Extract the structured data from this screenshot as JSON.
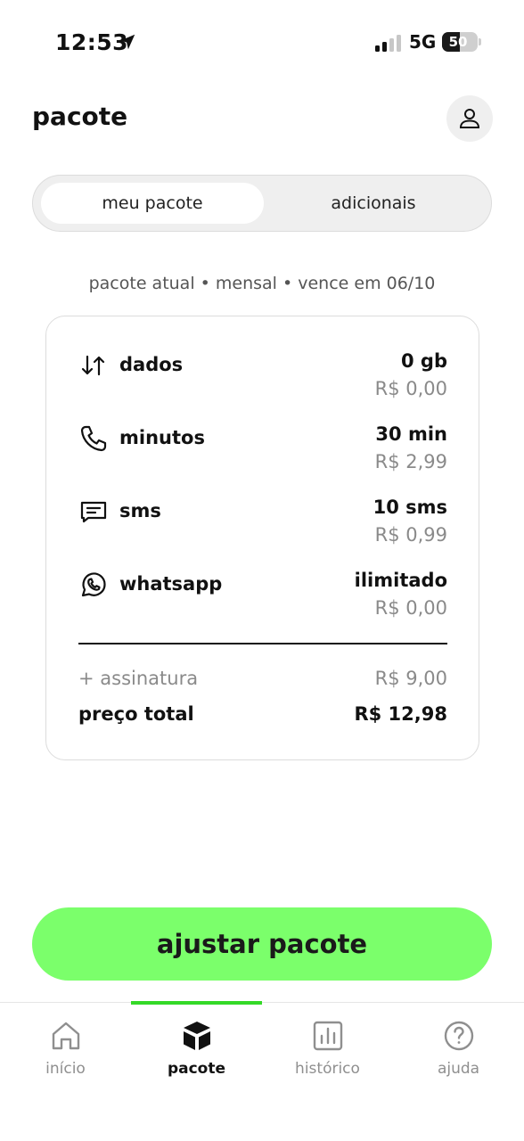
{
  "status_bar": {
    "time": "12:53",
    "network": "5G",
    "battery": "50",
    "battery_level": 0.5,
    "icons": [
      "location-arrow-icon",
      "signal-icon",
      "battery-icon"
    ]
  },
  "header": {
    "title": "pacote",
    "profile_icon": "user-icon"
  },
  "tabs": [
    {
      "label": "meu pacote",
      "active": true
    },
    {
      "label": "adicionais",
      "active": false
    }
  ],
  "plan": {
    "subtitle": "pacote atual • mensal • vence em 06/10",
    "items": [
      {
        "icon": "data-transfer-icon",
        "label": "dados",
        "amount": "0 gb",
        "price": "R$ 0,00"
      },
      {
        "icon": "phone-icon",
        "label": "minutos",
        "amount": "30 min",
        "price": "R$ 2,99"
      },
      {
        "icon": "message-icon",
        "label": "sms",
        "amount": "10 sms",
        "price": "R$ 0,99"
      },
      {
        "icon": "whatsapp-icon",
        "label": "whatsapp",
        "amount": "ilimitado",
        "price": "R$ 0,00"
      }
    ],
    "subscription_label": "+ assinatura",
    "subscription_price": "R$ 9,00",
    "total_label": "preço total",
    "total_price": "R$ 12,98"
  },
  "cta": {
    "label": "ajustar pacote"
  },
  "nav": {
    "accent_color": "#34d927",
    "items": [
      {
        "label": "início",
        "icon": "home-icon",
        "active": false
      },
      {
        "label": "pacote",
        "icon": "package-icon",
        "active": true
      },
      {
        "label": "histórico",
        "icon": "chart-icon",
        "active": false
      },
      {
        "label": "ajuda",
        "icon": "help-icon",
        "active": false
      }
    ]
  },
  "colors": {
    "cta_background": "#7bff6b",
    "muted_text": "#8a8a8a"
  }
}
